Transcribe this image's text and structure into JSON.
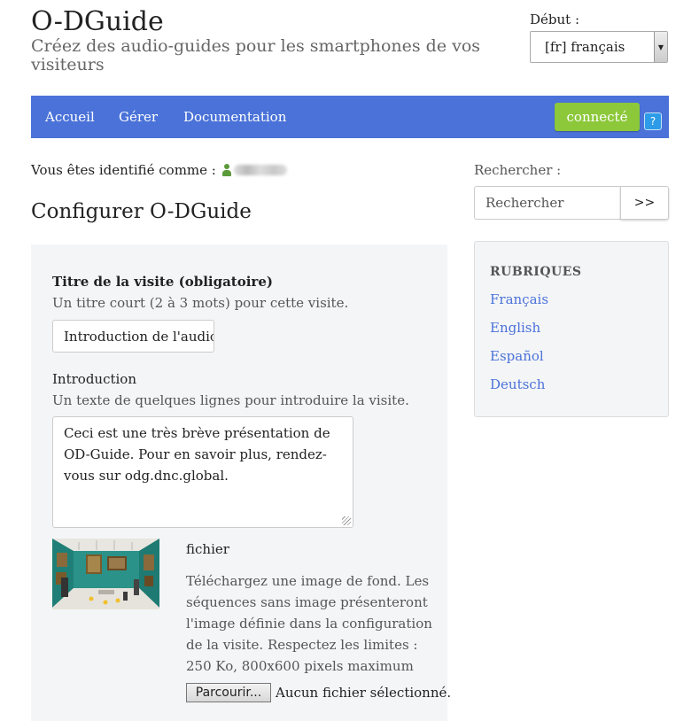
{
  "header": {
    "title": "O-DGuide",
    "subtitle": "Créez des audio-guides pour les smartphones de vos visiteurs",
    "language_label": "Début :",
    "language_value": "[fr] français"
  },
  "nav": {
    "items": [
      {
        "label": "Accueil"
      },
      {
        "label": "Gérer"
      },
      {
        "label": "Documentation"
      }
    ],
    "connect_label": "connecté",
    "help_label": "?"
  },
  "user": {
    "identified_label": "Vous êtes identifié comme :"
  },
  "main": {
    "page_title": "Configurer O-DGuide",
    "form": {
      "title_label": "Titre de la visite (obligatoire)",
      "title_help": "Un titre court (2 à 3 mots) pour cette visite.",
      "title_value": "Introduction de l'audio",
      "intro_label": "Introduction",
      "intro_help": "Un texte de quelques lignes pour introduire la visite.",
      "intro_value": "Ceci est une très brève présentation de OD-Guide. Pour en savoir plus, rendez-vous sur odg.dnc.global.",
      "file_label": "fichier",
      "file_help": "Téléchargez une image de fond. Les séquences sans image présenteront l'image définie dans la configuration de la visite. Respectez les limites : 250 Ko, 800x600 pixels maximum",
      "browse_label": "Parcourir...",
      "no_file_label": "Aucun fichier sélectionné."
    }
  },
  "sidebar": {
    "search_label": "Rechercher :",
    "search_placeholder": "Rechercher",
    "search_button": ">>",
    "rubriques_title": "RUBRIQUES",
    "rubriques": [
      {
        "label": "Français"
      },
      {
        "label": "English"
      },
      {
        "label": "Español"
      },
      {
        "label": "Deutsch"
      }
    ]
  },
  "colors": {
    "nav_bg": "#4a72d8",
    "connect_bg": "#8cc83a",
    "help_bg": "#2d9be8",
    "link": "#4a72d8",
    "panel_bg": "#f4f5f7"
  },
  "icons": {
    "user": "user-icon",
    "help": "help-icon",
    "select_arrow": "chevron-down-icon"
  }
}
